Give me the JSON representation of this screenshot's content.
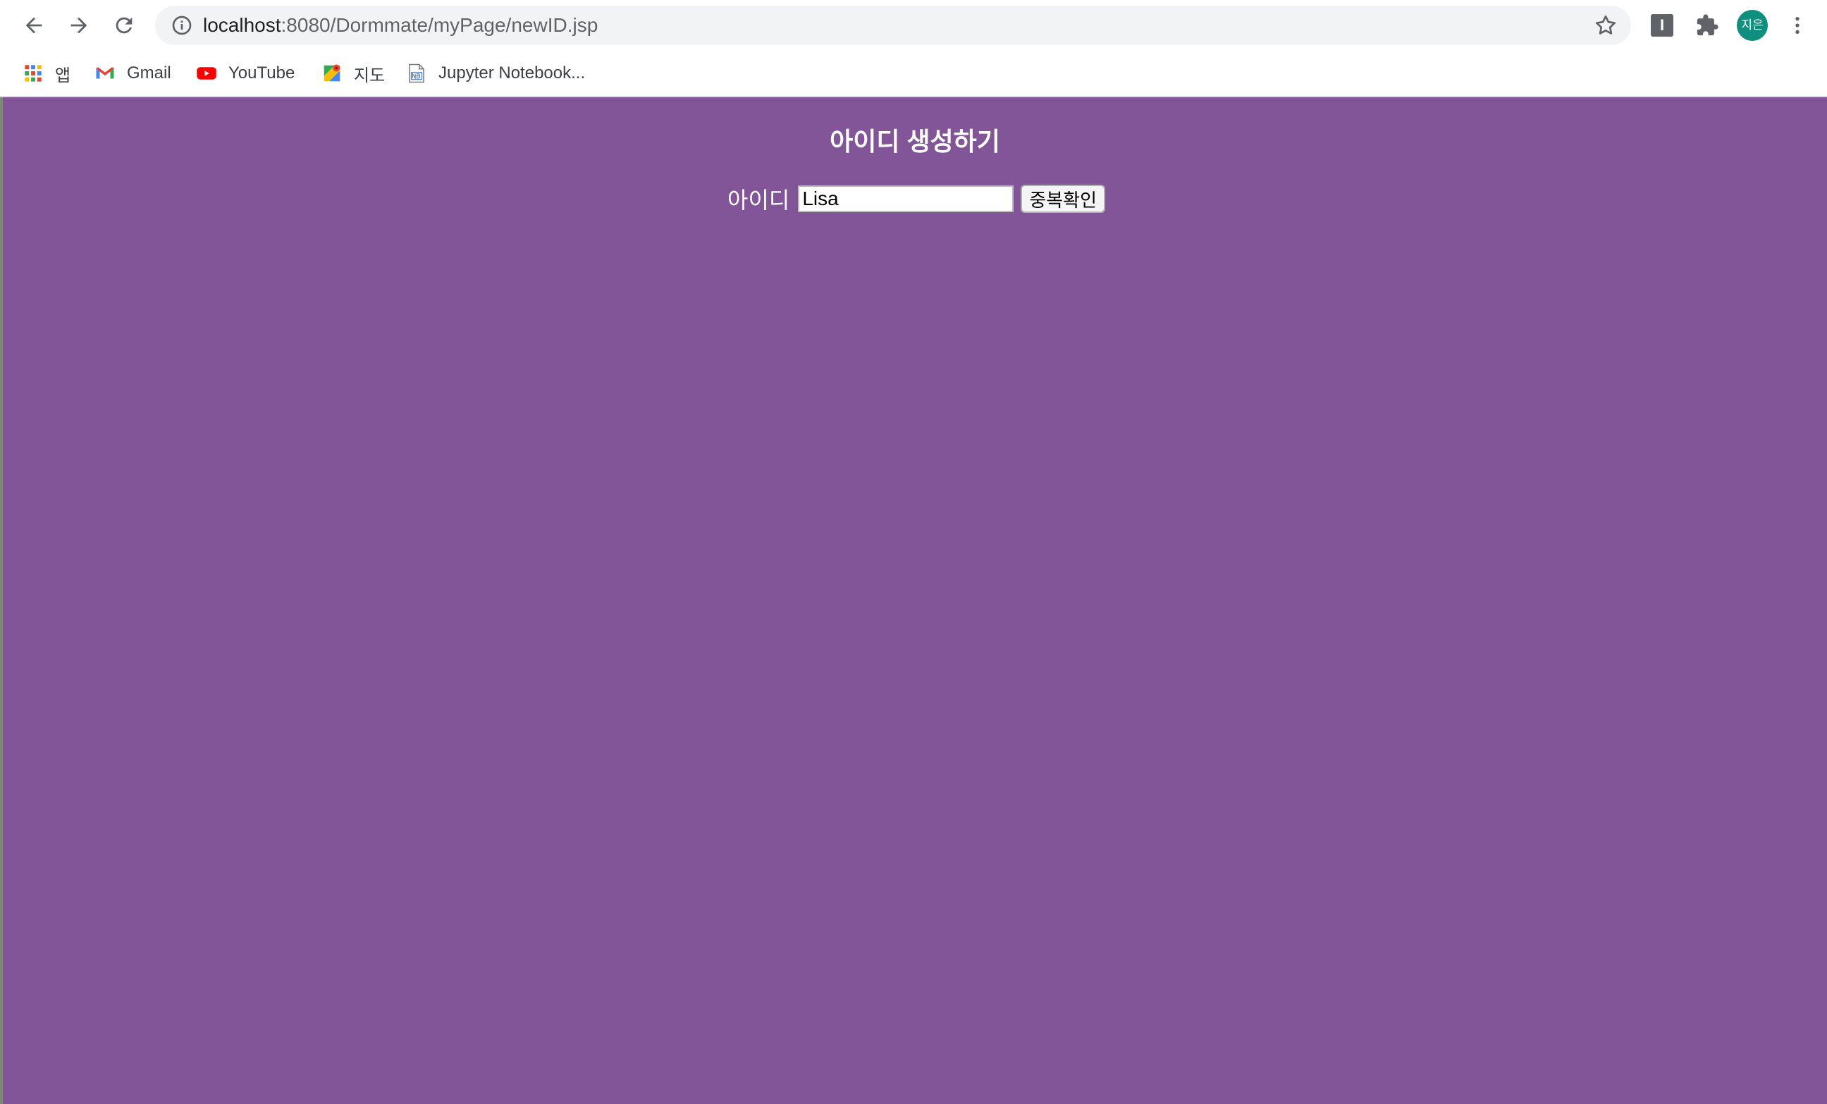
{
  "browser": {
    "url_host": "localhost",
    "url_path": ":8080/Dormmate/myPage/newID.jsp",
    "profile_label": "지은",
    "extension_label": "I"
  },
  "bookmarks": [
    {
      "label": "앱",
      "icon": "apps-grid-icon"
    },
    {
      "label": "Gmail",
      "icon": "gmail-icon"
    },
    {
      "label": "YouTube",
      "icon": "youtube-icon"
    },
    {
      "label": "지도",
      "icon": "maps-icon"
    },
    {
      "label": "Jupyter Notebook...",
      "icon": "notebook-icon"
    }
  ],
  "page": {
    "title": "아이디 생성하기",
    "id_label": "아이디",
    "id_value": "Lisa",
    "check_button": "중복확인",
    "background_color": "#825498"
  }
}
